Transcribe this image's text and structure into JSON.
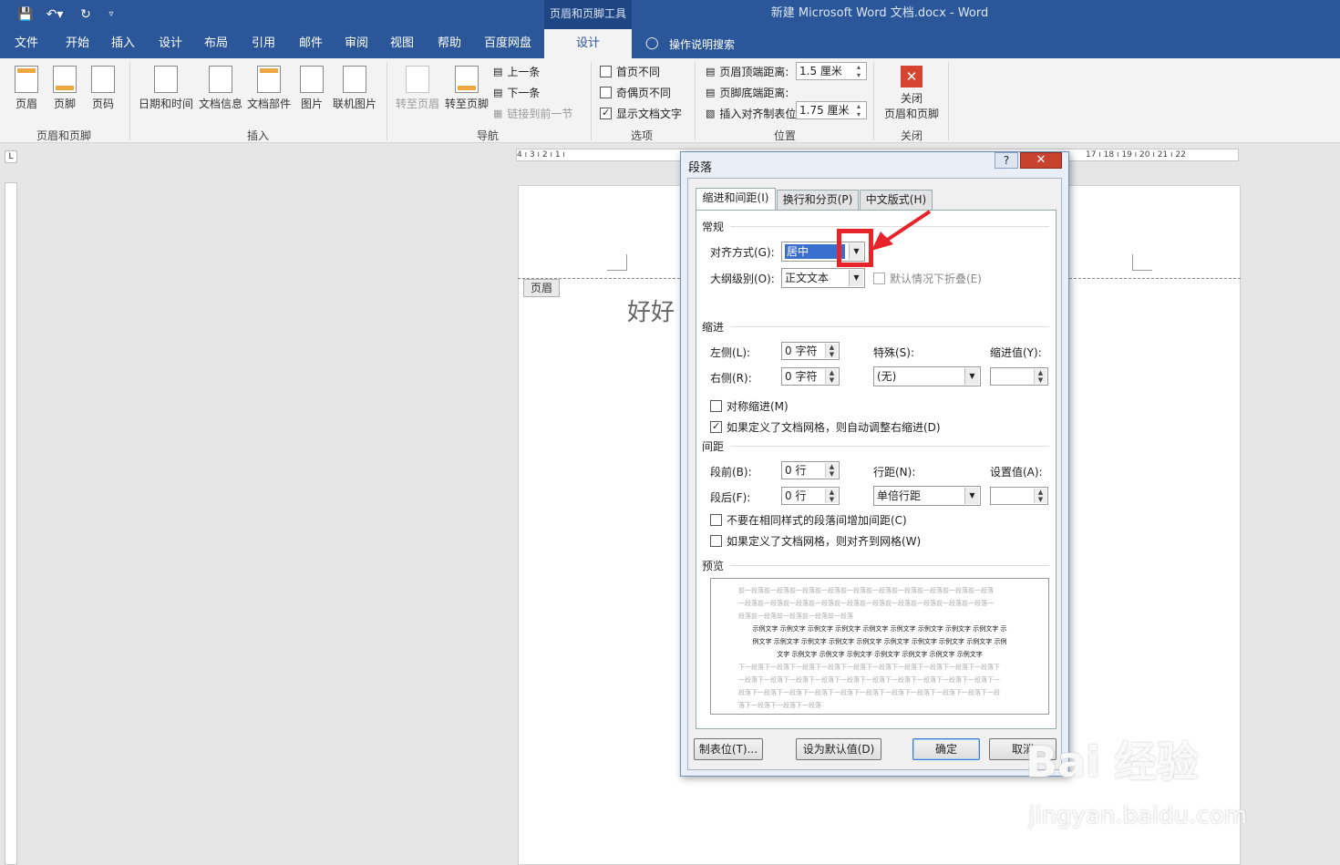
{
  "titlebar": {
    "contextual_tab": "页眉和页脚工具",
    "doc_title": "新建 Microsoft Word 文档.docx  -  Word",
    "qa_save_icon": "save-icon",
    "qa_undo_icon": "undo-icon",
    "qa_redo_icon": "redo-icon"
  },
  "tabs": [
    "文件",
    "开始",
    "插入",
    "设计",
    "布局",
    "引用",
    "邮件",
    "审阅",
    "视图",
    "帮助",
    "百度网盘",
    "设计"
  ],
  "tell_me": "操作说明搜索",
  "ribbon": {
    "group1": {
      "label": "页眉和页脚",
      "items": [
        "页眉",
        "页脚",
        "页码"
      ]
    },
    "group2": {
      "label": "插入",
      "items": [
        "日期和时间",
        "文档信息",
        "文档部件",
        "图片",
        "联机图片"
      ]
    },
    "group3": {
      "label": "导航",
      "goto_header": "转至页眉",
      "goto_footer": "转至页脚",
      "prev": "上一条",
      "next": "下一条",
      "link_prev": "链接到前一节"
    },
    "group4": {
      "label": "选项",
      "first_page": "首页不同",
      "odd_even": "奇偶页不同",
      "show_text": "显示文档文字"
    },
    "group5": {
      "label": "位置",
      "header_top": "页眉顶端距离:",
      "header_top_val": "1.5 厘米",
      "footer_bottom": "页脚底端距离:",
      "footer_bottom_val": "1.75 厘米",
      "insert_tab": "插入对齐制表位"
    },
    "group6": {
      "label": "关闭",
      "close_line1": "关闭",
      "close_line2": "页眉和页脚"
    }
  },
  "ruler_left": "4 ı 3 ı 2 ı 1 ı",
  "ruler_right": "17 ı 18 ı 19 ı 20 ı 21 ı 22",
  "document": {
    "header_tag": "页眉",
    "text": "好好"
  },
  "dialog": {
    "title": "段落",
    "help": "?",
    "close": "✕",
    "tabs": [
      "缩进和间距(I)",
      "换行和分页(P)",
      "中文版式(H)"
    ],
    "general": {
      "section": "常规",
      "align_label": "对齐方式(G):",
      "align_value": "居中",
      "outline_label": "大纲级别(O):",
      "outline_value": "正文文本",
      "collapse_label": "默认情况下折叠(E)"
    },
    "indent": {
      "section": "缩进",
      "left_label": "左侧(L):",
      "left_value": "0 字符",
      "right_label": "右侧(R):",
      "right_value": "0 字符",
      "special_label": "特殊(S):",
      "special_value": "(无)",
      "by_label": "缩进值(Y):",
      "mirror": "对称缩进(M)",
      "auto_adjust": "如果定义了文档网格，则自动调整右缩进(D)"
    },
    "spacing": {
      "section": "间距",
      "before_label": "段前(B):",
      "before_value": "0 行",
      "after_label": "段后(F):",
      "after_value": "0 行",
      "line_label": "行距(N):",
      "line_value": "单倍行距",
      "at_label": "设置值(A):",
      "no_space": "不要在相同样式的段落间增加间距(C)",
      "snap_grid": "如果定义了文档网格，则对齐到网格(W)"
    },
    "preview": {
      "section": "预览",
      "prev_lines": [
        "前一段落前一段落前一段落前一段落前一段落前一段落前一段落前一段落前一段落前一段落",
        "一段落前一段落前一段落前一段落前一段落前一段落前一段落前一段落前一段落前一段落一",
        "段落前一段落前一段落前一段落前一段落"
      ],
      "sample_lines": [
        "示例文字 示例文字 示例文字 示例文字 示例文字 示例文字 示例文字 示例文字 示例文字 示",
        "例文字 示例文字 示例文字 示例文字 示例文字 示例文字 示例文字 示例文字 示例文字 示例",
        "文字 示例文字 示例文字 示例文字 示例文字 示例文字 示例文字 示例文字"
      ],
      "next_lines": [
        "下一段落下一段落下一段落下一段落下一段落下一段落下一段落下一段落下一段落下一段落下",
        "一段落下一段落下一段落下一段落下一段落下一段落下一段落下一段落下一段落下一段落下一",
        "段落下一段落下一段落下一段落下一段落下一段落下一段落下一段落下一段落下一段落下一段",
        "落下一段落下一段落下一段落"
      ]
    },
    "buttons": {
      "tabs": "制表位(T)...",
      "set_default": "设为默认值(D)",
      "ok": "确定",
      "cancel": "取消"
    }
  },
  "watermark": {
    "brand": "Bai 经验",
    "url": "jingyan.baidu.com"
  },
  "colors": {
    "brand": "#2b579a",
    "annotation": "#e8242b"
  }
}
